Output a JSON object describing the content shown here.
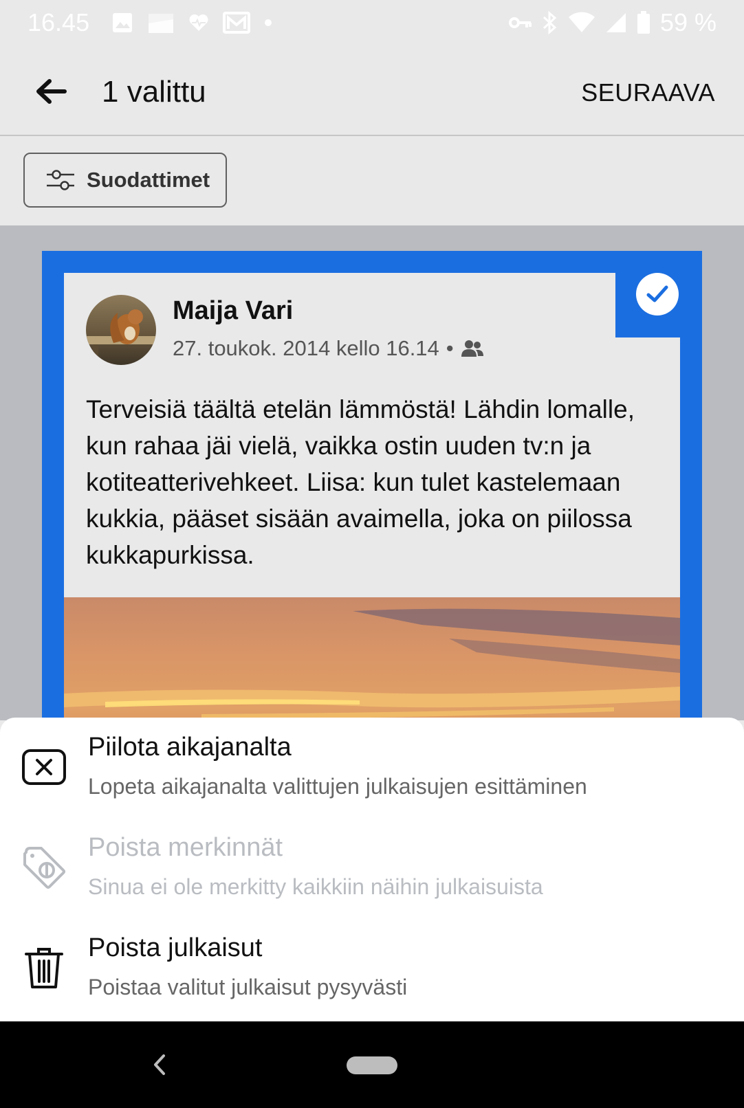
{
  "status_bar": {
    "time": "16.45",
    "battery": "59 %",
    "left_icons": [
      "image-icon",
      "sim-icon",
      "health-icon",
      "mail-icon",
      "dot-icon"
    ],
    "right_icons": [
      "vpn-key-icon",
      "bluetooth-icon",
      "wifi-icon",
      "signal-icon",
      "battery-icon"
    ]
  },
  "app_bar": {
    "title": "1 valittu",
    "next_label": "SEURAAVA"
  },
  "filters": {
    "label": "Suodattimet"
  },
  "post": {
    "author": "Maija Vari",
    "date": "27. toukok. 2014 kello 16.14",
    "separator": "•",
    "audience_icon": "friends-icon",
    "text": "Terveisiä täältä etelän lämmöstä! Lähdin lomalle, kun rahaa jäi vielä, vaikka ostin uuden tv:n ja kotiteatterivehkeet. Liisa: kun tulet kastelemaan kukkia, pääset sisään avaimella, joka on piilossa kukkapurkissa.",
    "selected": true
  },
  "sheet": {
    "options": [
      {
        "title": "Piilota aikajanalta",
        "subtitle": "Lopeta aikajanalta valittujen julkaisujen esittäminen",
        "icon": "hide-icon",
        "enabled": true
      },
      {
        "title": "Poista merkinnät",
        "subtitle": "Sinua ei ole merkitty kaikkiin näihin julkaisuista",
        "icon": "tag-icon",
        "enabled": false
      },
      {
        "title": "Poista julkaisut",
        "subtitle": "Poistaa valitut julkaisut pysyvästi",
        "icon": "trash-icon",
        "enabled": true
      }
    ]
  },
  "colors": {
    "accent": "#1b6ee0",
    "background": "#e9e9e9",
    "disabled_text": "#b9bcc1"
  }
}
